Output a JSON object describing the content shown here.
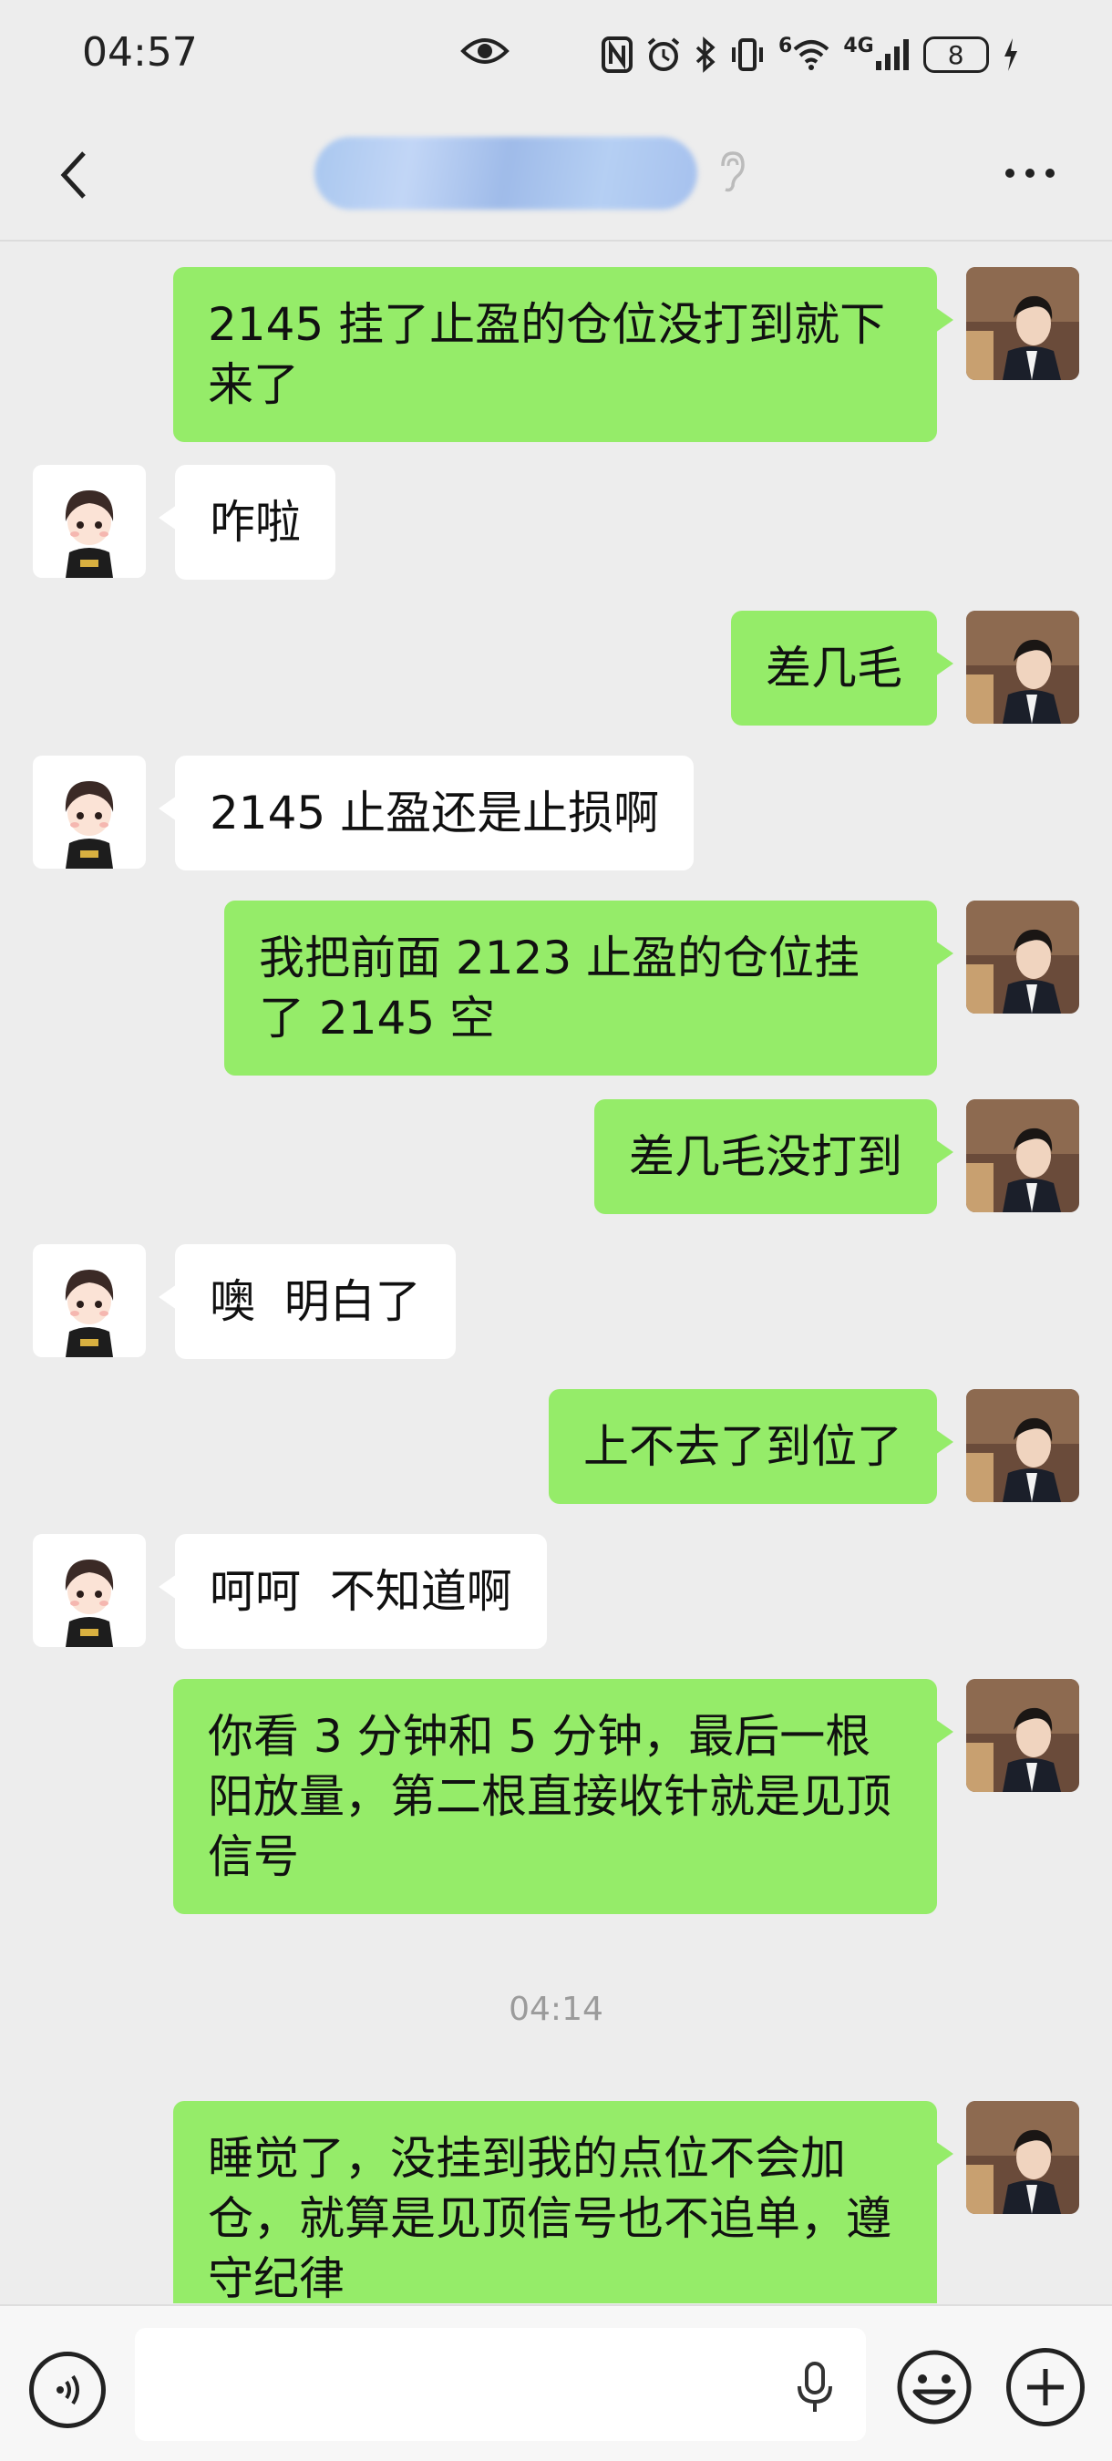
{
  "status_bar": {
    "time": "04:57",
    "network_label": "4G",
    "wifi_label": "6",
    "battery_level": "8",
    "icons": [
      "eye-icon",
      "nfc-icon",
      "alarm-icon",
      "bluetooth-icon",
      "vibrate-icon",
      "wifi-icon",
      "signal-icon",
      "battery-icon",
      "charging-icon"
    ]
  },
  "header": {
    "title": "",
    "back_icon": "chevron-left-icon",
    "more_icon": "more-icon",
    "ear_icon": "ear-icon"
  },
  "messages": [
    {
      "side": "out",
      "text": "2145 挂了止盈的仓位没打到就下来了"
    },
    {
      "side": "in",
      "text": "咋啦"
    },
    {
      "side": "out",
      "text": "差几毛"
    },
    {
      "side": "in",
      "text": "2145 止盈还是止损啊"
    },
    {
      "side": "out",
      "text": "我把前面 2123 止盈的仓位挂了 2145 空"
    },
    {
      "side": "out",
      "text": "差几毛没打到"
    },
    {
      "side": "in",
      "text": "噢  明白了"
    },
    {
      "side": "out",
      "text": "上不去了到位了"
    },
    {
      "side": "in",
      "text": "呵呵  不知道啊"
    },
    {
      "side": "out",
      "text": "你看 3 分钟和 5 分钟，最后一根阳放量，第二根直接收针就是见顶信号"
    },
    {
      "side": "time",
      "text": "04:14"
    },
    {
      "side": "out",
      "text": "睡觉了，没挂到我的点位不会加仓，就算是见顶信号也不追单，遵守纪律"
    }
  ],
  "input_bar": {
    "placeholder": "",
    "value": "",
    "icons": [
      "voice-icon",
      "microphone-icon",
      "emoji-icon",
      "plus-icon"
    ]
  },
  "colors": {
    "background": "#ededed",
    "outgoing_bubble": "#95ec69",
    "incoming_bubble": "#ffffff"
  }
}
